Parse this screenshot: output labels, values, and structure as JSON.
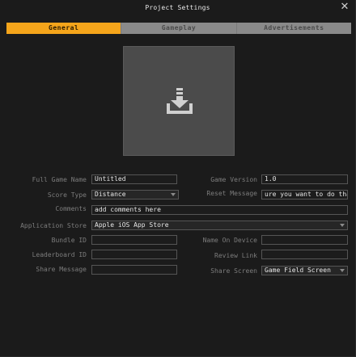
{
  "window": {
    "title": "Project Settings"
  },
  "tabs": [
    {
      "label": "General",
      "active": true
    },
    {
      "label": "Gameplay",
      "active": false
    },
    {
      "label": "Advertisements",
      "active": false
    }
  ],
  "app_icon": {
    "icon": "download-icon"
  },
  "form": {
    "full_game_name": {
      "label": "Full Game Name",
      "value": "Untitled"
    },
    "game_version": {
      "label": "Game Version",
      "value": "1.0"
    },
    "score_type": {
      "label": "Score Type",
      "value": "Distance"
    },
    "reset_message": {
      "label": "Reset Message",
      "value": "ure you want to do that?"
    },
    "comments": {
      "label": "Comments",
      "value": "add comments here"
    },
    "application_store": {
      "label": "Application Store",
      "value": "Apple iOS App Store"
    },
    "bundle_id": {
      "label": "Bundle ID",
      "value": ""
    },
    "name_on_device": {
      "label": "Name On Device",
      "value": ""
    },
    "leaderboard_id": {
      "label": "Leaderboard ID",
      "value": ""
    },
    "review_link": {
      "label": "Review Link",
      "value": ""
    },
    "share_message": {
      "label": "Share Message",
      "value": ""
    },
    "share_screen": {
      "label": "Share Screen",
      "value": "Game Field Screen"
    }
  },
  "colors": {
    "accent": "#f5a51b",
    "background": "#1b1b1b",
    "tab_inactive": "#8a8a8a",
    "label": "#7c7c7c"
  }
}
